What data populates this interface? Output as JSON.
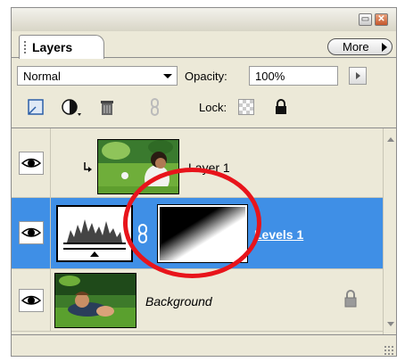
{
  "window": {
    "minimize_glyph": "▭",
    "close_glyph": "✕"
  },
  "panel": {
    "tab_label": "Layers",
    "more_label": "More"
  },
  "blend": {
    "mode": "Normal",
    "opacity_label": "Opacity:",
    "opacity_value": "100%"
  },
  "toolbar": {
    "lock_label": "Lock:",
    "icons": [
      "new-layer-icon",
      "adjustment-layer-icon",
      "trash-icon",
      "link-icon"
    ]
  },
  "layers": [
    {
      "name": "Layer 1",
      "visible": true,
      "clipped": true,
      "selected": false
    },
    {
      "name": "Levels 1",
      "visible": true,
      "type": "adjustment-levels",
      "has_mask": true,
      "selected": true
    },
    {
      "name": "Background",
      "visible": true,
      "locked": true,
      "selected": false
    }
  ],
  "colors": {
    "panel_bg": "#ece9d8",
    "selection": "#3f8fe6",
    "highlight_circle": "#e8141b"
  }
}
